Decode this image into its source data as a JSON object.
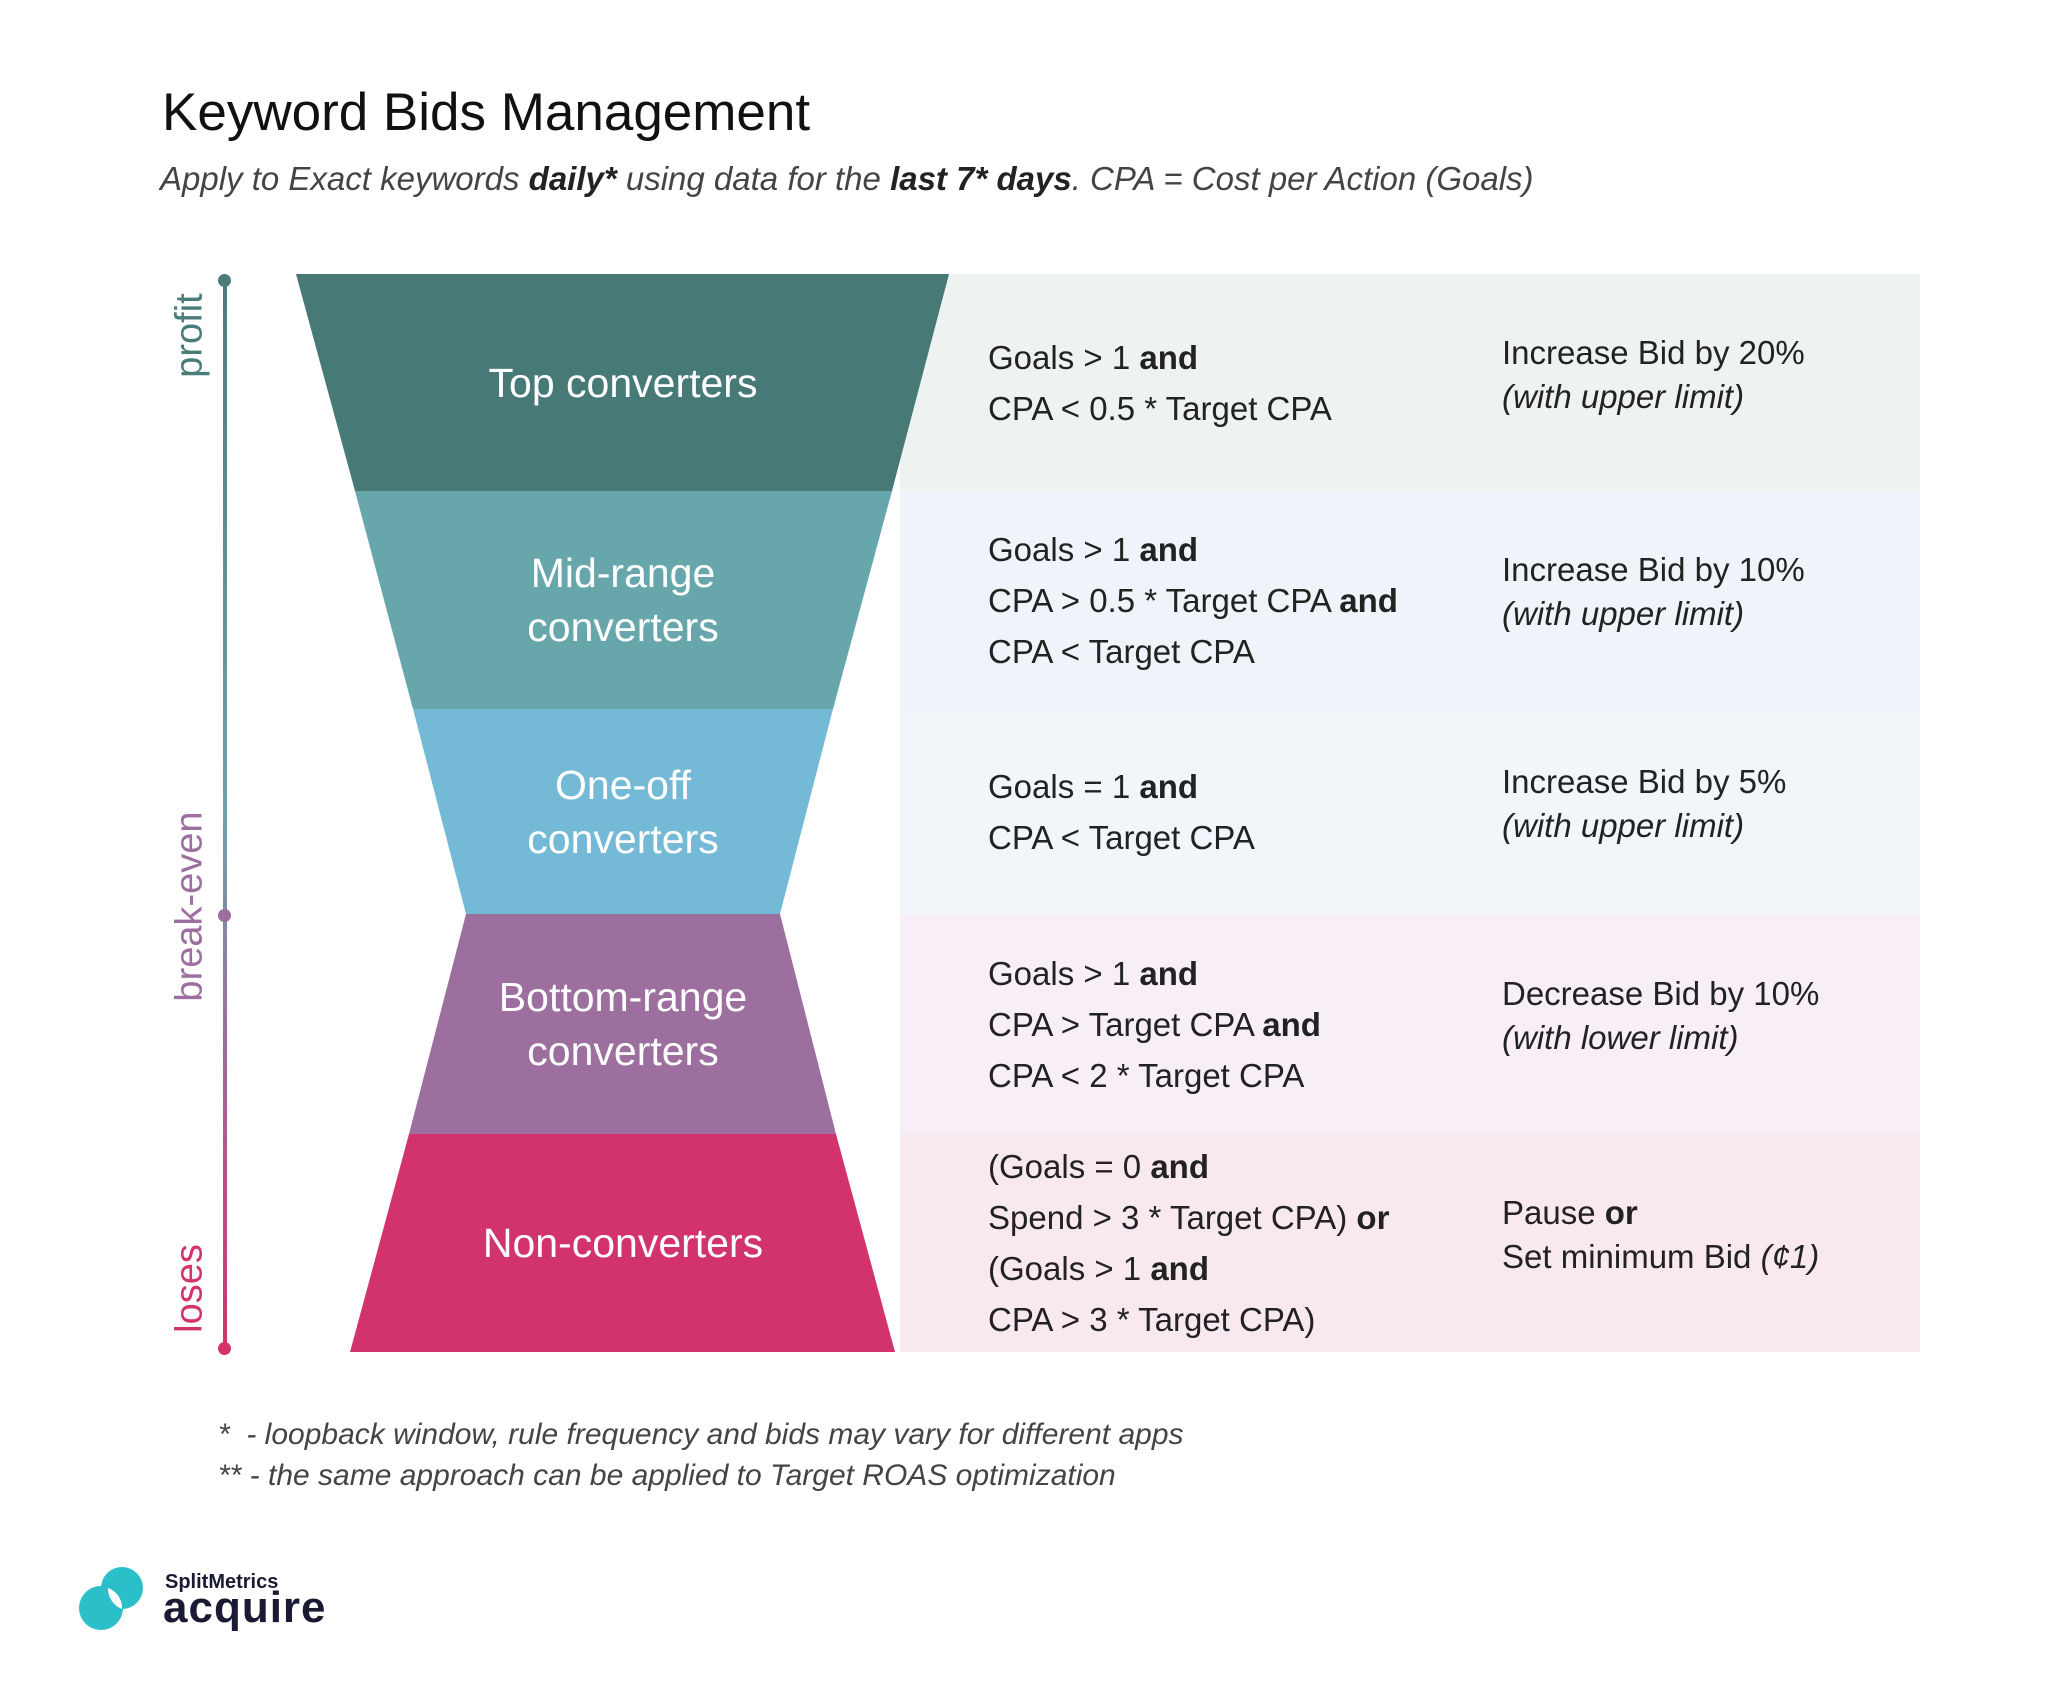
{
  "title": "Keyword Bids Management",
  "subtitle": [
    {
      "t": "Apply to Exact keywords ",
      "b": false
    },
    {
      "t": "daily*",
      "b": true
    },
    {
      "t": " using data for the ",
      "b": false
    },
    {
      "t": "last 7* days",
      "b": true
    },
    {
      "t": ". CPA = Cost per Action (Goals)",
      "b": false
    }
  ],
  "axis": {
    "profit": "profit",
    "break_even": "break-even",
    "loses": "loses",
    "colors": {
      "profit": "#4a7d79",
      "break_even": "#9c6f9f",
      "loses": "#d2336d"
    }
  },
  "rows": [
    {
      "label": [
        "Top converters"
      ],
      "color": "#477976",
      "bg": "#eef2f0",
      "conditions": [
        [
          {
            "t": "Goals > 1 ",
            "b": false
          },
          {
            "t": "and",
            "b": true
          }
        ],
        [
          {
            "t": "CPA < 0.5 * Target CPA",
            "b": false
          }
        ]
      ],
      "action": [
        [
          {
            "t": "Increase Bid by 20%",
            "i": false,
            "b": false
          }
        ],
        [
          {
            "t": "(with upper limit)",
            "i": true,
            "b": false
          }
        ]
      ]
    },
    {
      "label": [
        "Mid-range",
        "converters"
      ],
      "color": "#67a6ab",
      "bg": "#eef4f9",
      "conditions": [
        [
          {
            "t": "Goals > 1 ",
            "b": false
          },
          {
            "t": "and",
            "b": true
          }
        ],
        [
          {
            "t": "CPA > 0.5 * Target CPA ",
            "b": false
          },
          {
            "t": "and",
            "b": true
          }
        ],
        [
          {
            "t": "CPA < Target CPA",
            "b": false
          }
        ]
      ],
      "action": [
        [
          {
            "t": "Increase Bid by 10%",
            "i": false,
            "b": false
          }
        ],
        [
          {
            "t": "(with upper limit)",
            "i": true,
            "b": false
          }
        ]
      ]
    },
    {
      "label": [
        "One-off",
        "converters"
      ],
      "color": "#74bad6",
      "bg": "#f1f6fb",
      "conditions": [
        [
          {
            "t": "Goals = 1 ",
            "b": false
          },
          {
            "t": "and",
            "b": true
          }
        ],
        [
          {
            "t": "CPA < Target CPA",
            "b": false
          }
        ]
      ],
      "action": [
        [
          {
            "t": "Increase Bid by 5%",
            "i": false,
            "b": false
          }
        ],
        [
          {
            "t": "(with upper limit)",
            "i": true,
            "b": false
          }
        ]
      ]
    },
    {
      "label": [
        "Bottom-range",
        "converters"
      ],
      "color": "#9c6f9f",
      "bg": "#f8eef8",
      "conditions": [
        [
          {
            "t": "Goals > 1 ",
            "b": false
          },
          {
            "t": "and",
            "b": true
          }
        ],
        [
          {
            "t": "CPA > Target CPA ",
            "b": false
          },
          {
            "t": "and",
            "b": true
          }
        ],
        [
          {
            "t": "CPA < 2 * Target CPA",
            "b": false
          }
        ]
      ],
      "action": [
        [
          {
            "t": "Decrease Bid by 10%",
            "i": false,
            "b": false
          }
        ],
        [
          {
            "t": "(with lower limit)",
            "i": true,
            "b": false
          }
        ]
      ]
    },
    {
      "label": [
        "Non-converters"
      ],
      "color": "#d2336d",
      "bg": "#f8e8ef",
      "conditions": [
        [
          {
            "t": "(Goals = 0 ",
            "b": false
          },
          {
            "t": "and",
            "b": true
          }
        ],
        [
          {
            "t": "Spend > 3 * Target CPA) ",
            "b": false
          },
          {
            "t": "or",
            "b": true
          }
        ],
        [
          {
            "t": "(Goals > 1 ",
            "b": false
          },
          {
            "t": "and",
            "b": true
          }
        ],
        [
          {
            "t": "CPA > 3 * Target CPA)",
            "b": false
          }
        ]
      ],
      "action": [
        [
          {
            "t": "Pause ",
            "i": false,
            "b": false
          },
          {
            "t": "or",
            "i": false,
            "b": true
          }
        ],
        [
          {
            "t": "Set minimum Bid ",
            "i": false,
            "b": false
          },
          {
            "t": "(¢1)",
            "i": true,
            "b": false
          }
        ]
      ]
    }
  ],
  "footnotes": [
    "*  - loopback window, rule frequency and bids may vary for different apps",
    "** - the same approach can be applied to Target ROAS optimization"
  ],
  "logo": {
    "small": "SplitMetrics",
    "big": "acquire",
    "color": "#2bbfc9"
  }
}
